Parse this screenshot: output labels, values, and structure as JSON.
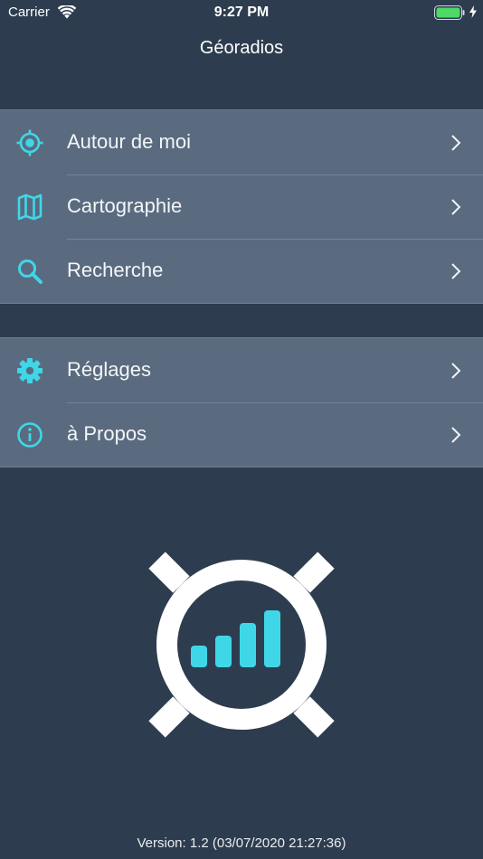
{
  "status_bar": {
    "carrier": "Carrier",
    "time": "9:27 PM",
    "wifi_icon": "wifi-icon",
    "battery_icon": "battery-charging-icon"
  },
  "nav": {
    "title": "Géoradios"
  },
  "menu_groups": [
    {
      "items": [
        {
          "label": "Autour de moi",
          "icon": "location-target-icon"
        },
        {
          "label": "Cartographie",
          "icon": "map-icon"
        },
        {
          "label": "Recherche",
          "icon": "search-icon"
        }
      ]
    },
    {
      "items": [
        {
          "label": "Réglages",
          "icon": "gear-icon"
        },
        {
          "label": "à Propos",
          "icon": "info-icon"
        }
      ]
    }
  ],
  "footer": {
    "version": "Version: 1.2 (03/07/2020 21:27:36)"
  },
  "colors": {
    "background": "#2d3d4f",
    "row_background": "#5a6b80",
    "accent": "#3fd7e8",
    "text": "#ffffff"
  }
}
